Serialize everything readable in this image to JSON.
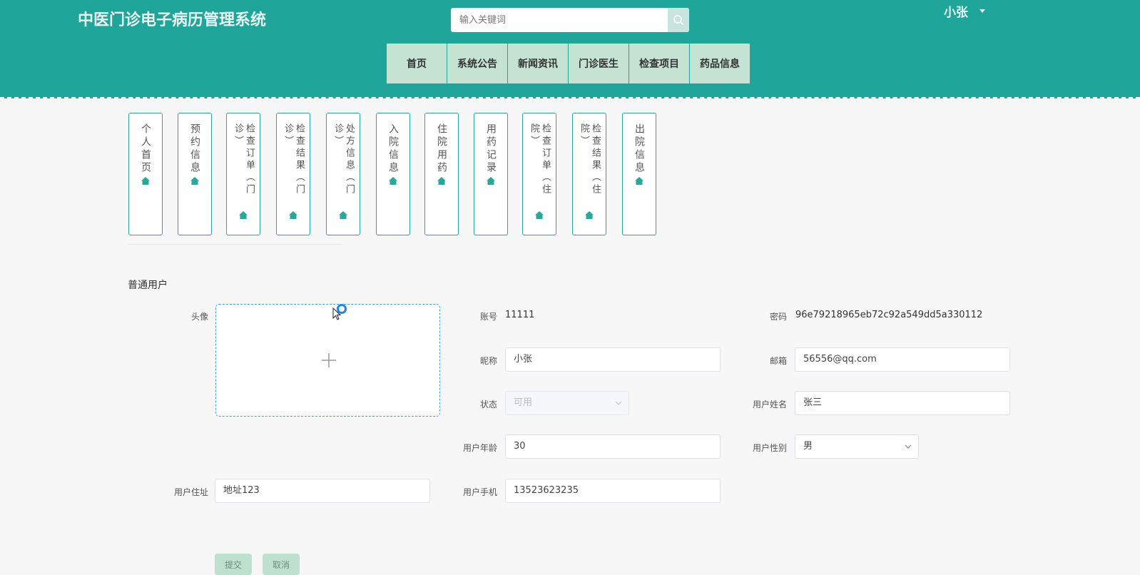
{
  "header": {
    "site_title": "中医门诊电子病历管理系统",
    "search_placeholder": "输入关键词",
    "user_name": "小张"
  },
  "nav": [
    "首页",
    "系统公告",
    "新闻资讯",
    "门诊医生",
    "检查项目",
    "药品信息"
  ],
  "side_menu": [
    "个人首页",
    "预约信息",
    "检查订单（门诊）",
    "检查结果（门诊）",
    "处方信息（门诊）",
    "入院信息",
    "住院用药",
    "用药记录",
    "检查订单（住院）",
    "检查结果（住院）",
    "出院信息"
  ],
  "form": {
    "section_title": "普通用户",
    "avatar_label": "头像",
    "account_label": "账号",
    "account_value": "11111",
    "password_label": "密码",
    "password_value": "96e79218965eb72c92a549dd5a330112",
    "nickname_label": "昵称",
    "nickname_value": "小张",
    "email_label": "邮箱",
    "email_value": "56556@qq.com",
    "status_label": "状态",
    "status_value": "可用",
    "real_name_label": "用户姓名",
    "real_name_value": "张三",
    "age_label": "用户年龄",
    "age_value": "30",
    "gender_label": "用户性别",
    "gender_value": "男",
    "address_label": "用户住址",
    "address_value": "地址123",
    "phone_label": "用户手机",
    "phone_value": "13523623235",
    "submit_label": "提交",
    "cancel_label": "取消"
  },
  "colors": {
    "header_bg": "#1fa59a",
    "nav_bg": "#c5e3d3",
    "card_border": "#2aa79a",
    "button_bg": "#bfe0cf"
  }
}
